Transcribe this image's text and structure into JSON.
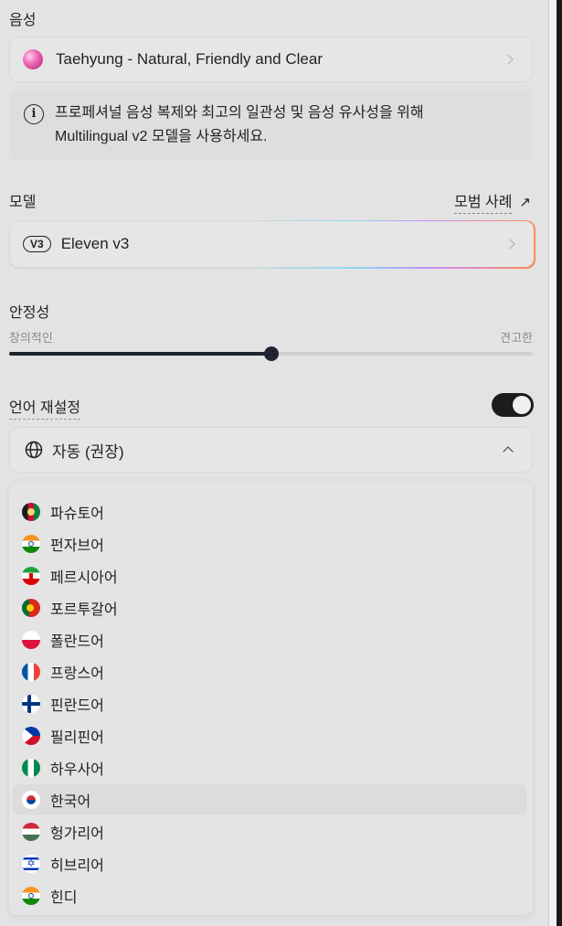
{
  "voice": {
    "section_label": "음성",
    "selected_voice": "Taehyung - Natural, Friendly and Clear",
    "info_text_line1": "프로페셔널 음성 복제와 최고의 일관성 및 음성 유사성을 위해",
    "info_text_line2": "Multilingual v2 모델을 사용하세요."
  },
  "model": {
    "section_label": "모델",
    "example_link": "모범 사례",
    "badge": "V3",
    "selected_model": "Eleven v3"
  },
  "stability": {
    "section_label": "안정성",
    "min_label": "창의적인",
    "max_label": "견고한",
    "value_fraction": 0.5
  },
  "language_override": {
    "section_label": "언어 재설정",
    "toggle_on": true,
    "selected_value": "자동 (권장)",
    "options": [
      {
        "label": "파슈토어",
        "flag": "af"
      },
      {
        "label": "펀자브어",
        "flag": "in"
      },
      {
        "label": "페르시아어",
        "flag": "ir"
      },
      {
        "label": "포르투갈어",
        "flag": "pt"
      },
      {
        "label": "폴란드어",
        "flag": "pl"
      },
      {
        "label": "프랑스어",
        "flag": "fr"
      },
      {
        "label": "핀란드어",
        "flag": "fi"
      },
      {
        "label": "필리핀어",
        "flag": "ph"
      },
      {
        "label": "하우사어",
        "flag": "ng"
      },
      {
        "label": "한국어",
        "flag": "kr",
        "highlighted": true
      },
      {
        "label": "헝가리어",
        "flag": "hu"
      },
      {
        "label": "히브리어",
        "flag": "il"
      },
      {
        "label": "힌디",
        "flag": "hi"
      }
    ]
  },
  "colors": {
    "panel_bg": "#e3e3e3",
    "slider_fill": "#1f2430",
    "toggle_bg": "#1c1c1c"
  }
}
